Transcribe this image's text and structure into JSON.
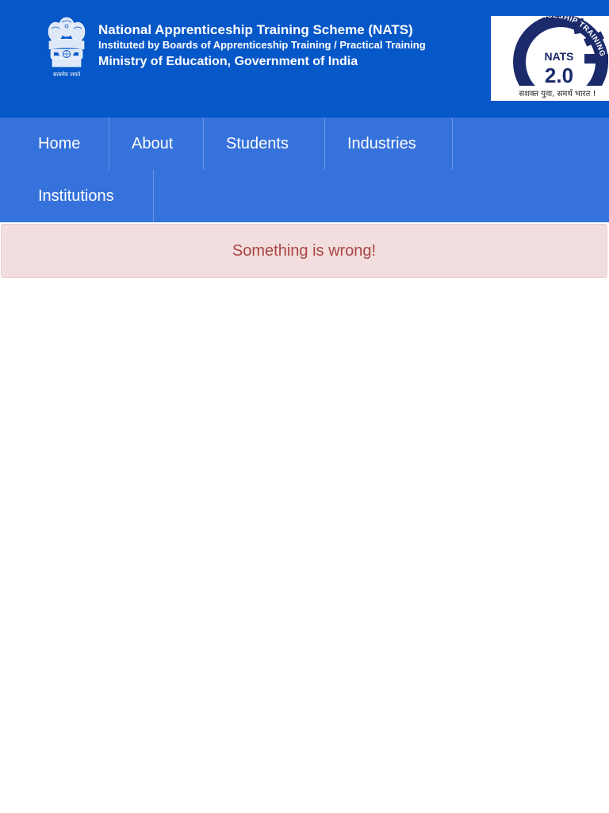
{
  "header": {
    "title": "National Apprenticeship Training Scheme (NATS)",
    "subtitle": "Instituted by Boards of Apprenticeship Training / Practical Training",
    "ministry": "Ministry of Education, Government of India",
    "emblem_caption": "सत्यमेव जयते",
    "logo": {
      "ring_text": "NATIONAL APPRENTICESHIP TRAINING",
      "name": "NATS",
      "version": "2.0",
      "tagline": "सशक्त युवा, समर्थ भारत !"
    },
    "colors": {
      "background": "#0657c8",
      "logo_navy": "#1b2a6b"
    }
  },
  "nav": {
    "items": [
      {
        "label": "Home"
      },
      {
        "label": "About"
      },
      {
        "label": "Students"
      },
      {
        "label": "Industries"
      },
      {
        "label": "Institutions"
      }
    ],
    "colors": {
      "background": "#3672db"
    }
  },
  "alert": {
    "message": "Something is wrong!",
    "colors": {
      "background": "#f2dede",
      "text": "#a94442"
    }
  }
}
